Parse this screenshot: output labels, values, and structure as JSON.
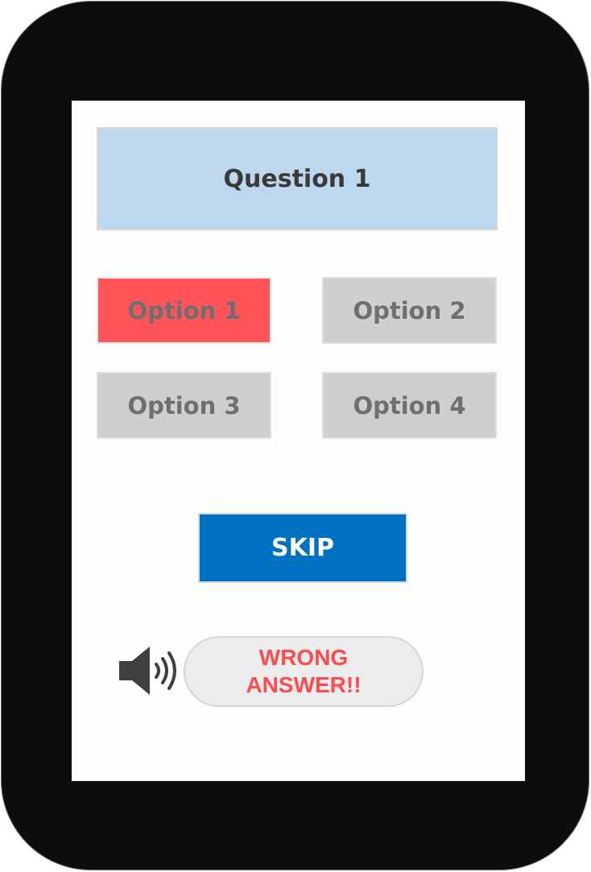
{
  "quiz": {
    "question": "Question 1",
    "options": [
      {
        "label": "Option 1",
        "state": "selected-wrong",
        "color": "#ff5458"
      },
      {
        "label": "Option 2",
        "state": "unselected",
        "color": "#d0cece"
      },
      {
        "label": "Option 3",
        "state": "unselected",
        "color": "#d0cece"
      },
      {
        "label": "Option 4",
        "state": "unselected",
        "color": "#d0cece"
      }
    ],
    "skip_label": "SKIP",
    "feedback": {
      "line1": "WRONG",
      "line2": "ANSWER!!",
      "color": "#ff4a4f"
    },
    "sound_icon": "speaker-sound-icon"
  },
  "colors": {
    "device_frame": "#0d0d0d",
    "question_bg": "#bdd7ee",
    "skip_bg": "#0070c0"
  }
}
